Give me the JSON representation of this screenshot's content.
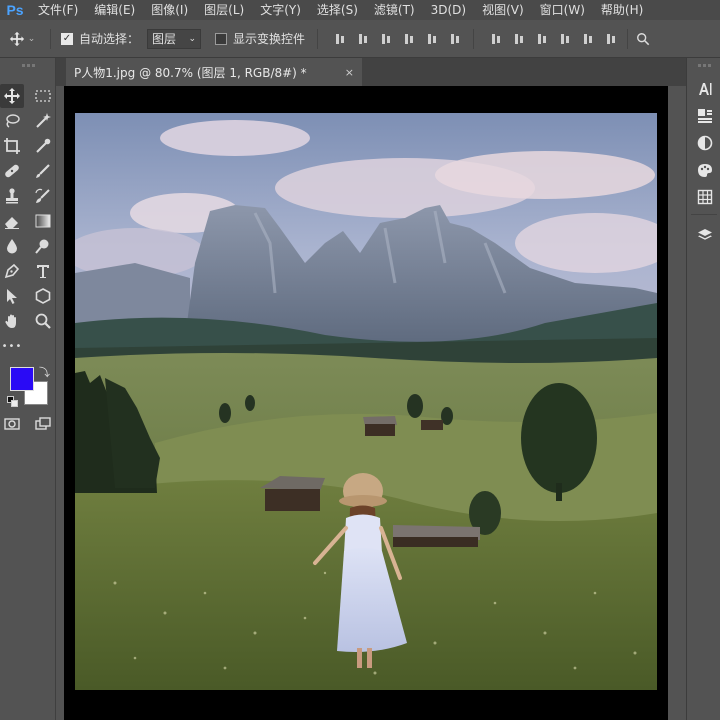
{
  "app": {
    "logo": "Ps",
    "menus": [
      "文件(F)",
      "编辑(E)",
      "图像(I)",
      "图层(L)",
      "文字(Y)",
      "选择(S)",
      "滤镜(T)",
      "3D(D)",
      "视图(V)",
      "窗口(W)",
      "帮助(H)"
    ]
  },
  "options": {
    "auto_select_label": "自动选择：",
    "auto_select_checked": true,
    "auto_select_target": "图层",
    "show_transform_label": "显示变换控件",
    "show_transform_checked": false
  },
  "document": {
    "tab_title": "P人物1.jpg @ 80.7% (图层 1, RGB/8#) *",
    "close_glyph": "×"
  },
  "toolbar": {
    "foreground_color": "#2a0af5",
    "background_color": "#ffffff",
    "more_glyph": "•••"
  },
  "colors": {
    "ui_bg": "#535353",
    "menu_bg": "#4a4a4a",
    "tab_bar_bg": "#424242",
    "accent_logo": "#4ba3ff"
  }
}
